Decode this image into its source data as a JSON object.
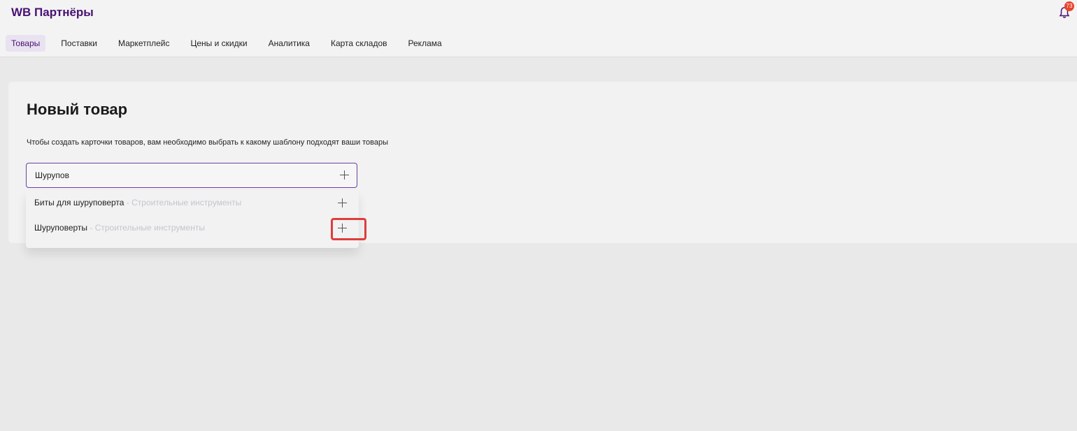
{
  "header": {
    "logo": "WB Партнёры",
    "notifications_count": "73"
  },
  "nav": {
    "items": [
      {
        "label": "Товары",
        "active": true
      },
      {
        "label": "Поставки"
      },
      {
        "label": "Маркетплейс"
      },
      {
        "label": "Цены и скидки"
      },
      {
        "label": "Аналитика"
      },
      {
        "label": "Карта складов"
      },
      {
        "label": "Реклама"
      }
    ]
  },
  "main": {
    "title": "Новый товар",
    "subtitle": "Чтобы создать карточки товаров, вам необходимо выбрать к какому шаблону подходят ваши товары",
    "search": {
      "value": "Шурупов",
      "add_icon": "plus-icon"
    },
    "suggestions": [
      {
        "name": "Биты для шуруповерта",
        "category": "Строительные инструменты"
      },
      {
        "name": "Шуруповерты",
        "category": "Строительные инструменты"
      }
    ]
  },
  "colors": {
    "brand": "#481173",
    "accent_border": "#6e3fa3",
    "highlight": "#e03c3c",
    "badge": "#e8452c"
  }
}
